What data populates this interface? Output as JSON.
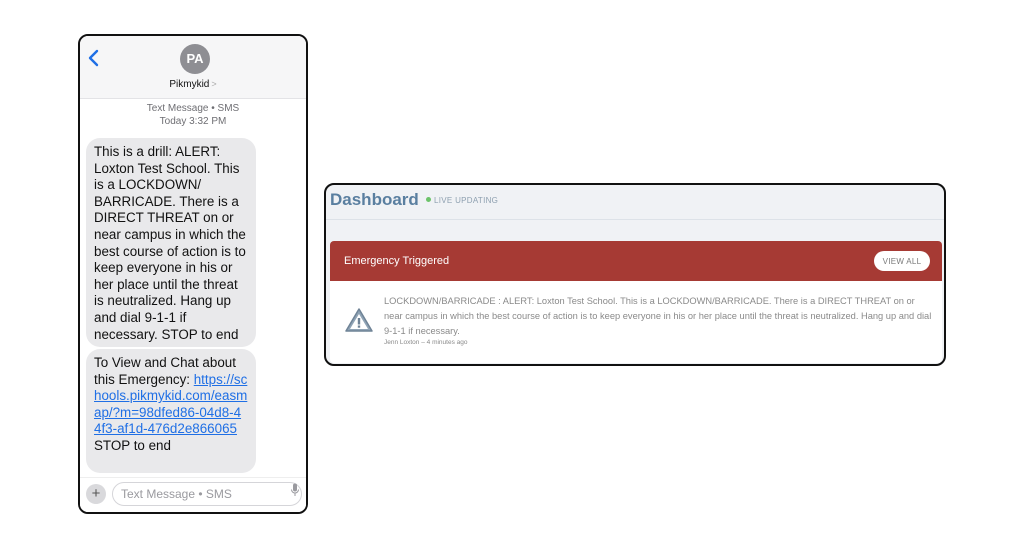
{
  "phone": {
    "contact_initials": "PA",
    "contact_name": "Pikmykid",
    "contact_chevron": ">",
    "message_type": "Text Message • SMS",
    "timestamp": "Today 3:32 PM",
    "messages": [
      {
        "text": "This is a drill: ALERT: Loxton Test School. This is a LOCKDOWN/ BARRICADE. There is a DIRECT THREAT on or near campus in which the best course of action is to keep everyone in his or her place until the threat is neutralized. Hang up and dial 9-1-1 if necessary. STOP to end"
      },
      {
        "prefix": "To View and Chat about this Emergency: ",
        "link": "https://schools.pikmykid.com/easmap/?m=98dfed86-04d8-44f3-af1d-476d2e866065",
        "suffix": "STOP to end"
      }
    ],
    "composer": {
      "placeholder": "Text Message • SMS",
      "plus": "+"
    }
  },
  "dashboard": {
    "title": "Dashboard",
    "live_label": "LIVE UPDATING",
    "panel": {
      "title": "Emergency Triggered",
      "view_all": "VIEW ALL",
      "alert_text": "LOCKDOWN/BARRICADE : ALERT: Loxton Test School. This is a LOCKDOWN/BARRICADE. There is a DIRECT THREAT on or near campus in which the best course of action is to keep everyone in his or her place until the threat is neutralized. Hang up and dial 9-1-1 if necessary.",
      "author": "Jenn Loxton",
      "age": "4 minutes ago"
    }
  },
  "colors": {
    "alert_red": "#a63a34",
    "link_blue": "#1f6fe5",
    "bubble_gray": "#e9e9eb",
    "dashboard_title": "#5a7fa0",
    "live_dot": "#6cc36a"
  },
  "icons": [
    "back-chevron-icon",
    "warning-triangle-icon",
    "microphone-icon",
    "plus-icon"
  ]
}
